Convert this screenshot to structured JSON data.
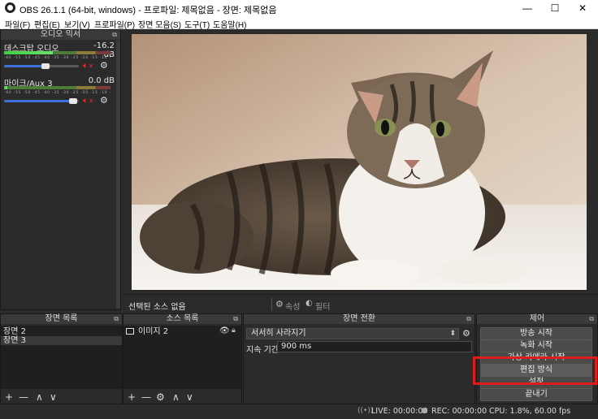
{
  "window": {
    "title": "OBS 26.1.1 (64-bit, windows) - 프로파일: 제목없음 - 장면: 제목없음",
    "minimize": "—",
    "maximize": "☐",
    "close": "✕"
  },
  "menu": [
    "파일(F)",
    "편집(E)",
    "보기(V)",
    "프로파일(P)",
    "장면 모음(S)",
    "도구(T)",
    "도움말(H)"
  ],
  "mixer": {
    "title": "오디오 믹서",
    "tracks": [
      {
        "name": "데스크탑 오디오",
        "level": "-16.2 dB",
        "volume_fraction": 0.55
      },
      {
        "name": "마이크/Aux 3",
        "level": "0.0 dB",
        "volume_fraction": 0.92
      }
    ],
    "ticks": "-60 -55 -50 -45 -40 -35 -30 -25 -20 -15 -10 -5 0"
  },
  "source_toolbar": {
    "selected": "선택된 소스 없음",
    "properties": "속성",
    "filters": "필터"
  },
  "scenes": {
    "title": "장면 목록",
    "items": [
      "장면 2",
      "장면 3"
    ]
  },
  "sources": {
    "title": "소스 목록",
    "items": [
      "이미지 2"
    ]
  },
  "transitions": {
    "title": "장면 전환",
    "selected": "서서히 사라지기",
    "duration_label": "지속 기간",
    "duration_value": "900 ms"
  },
  "controls": {
    "title": "제어",
    "buttons": [
      "방송 시작",
      "녹화 시작",
      "가상 카메라 시작",
      "편집 방식",
      "설정",
      "끝내기"
    ]
  },
  "status": {
    "live": "LIVE: 00:00:00",
    "rec": "REC: 00:00:00",
    "cpu": "CPU: 1.8%, 60.00 fps"
  },
  "colors": {
    "highlight": "#e01b1b",
    "accent": "#3f6fd8"
  }
}
